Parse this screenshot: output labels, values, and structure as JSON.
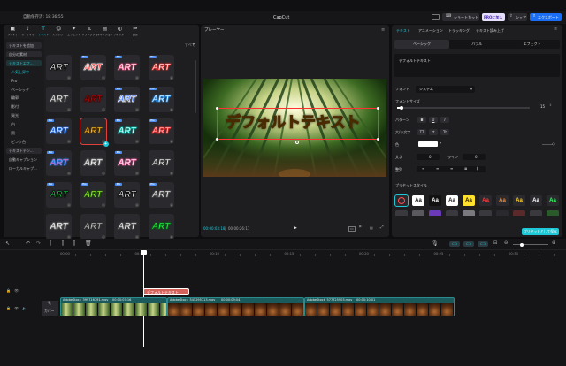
{
  "titlebar": {
    "autosave": "自動保存済: 18:36:55",
    "title": "CapCut",
    "shortcut": "ショートカット",
    "pro": "PROに加入",
    "share": "シェア",
    "export": "エクスポート"
  },
  "toolbar": {
    "tabs": [
      {
        "label": "メディア",
        "icon": "media-icon"
      },
      {
        "label": "オーディオ",
        "icon": "audio-icon"
      },
      {
        "label": "テキスト",
        "icon": "text-icon"
      },
      {
        "label": "ステッカー",
        "icon": "sticker-icon"
      },
      {
        "label": "エフェクト",
        "icon": "effect-icon"
      },
      {
        "label": "トランジション",
        "icon": "transition-icon"
      },
      {
        "label": "キャプション",
        "icon": "caption-icon"
      },
      {
        "label": "フィルター",
        "icon": "filter-icon"
      },
      {
        "label": "調整",
        "icon": "adjust-icon"
      }
    ]
  },
  "sidebar": {
    "items": [
      "テキストを追加",
      "自分の素材",
      "テキストエフ...",
      "人気上昇中",
      "Pro",
      "ベーシック",
      "輪郭",
      "影付",
      "発光",
      "白",
      "黒",
      "ピンク色",
      "テキストテン...",
      "自動キャプション",
      "ローカルキャプ..."
    ]
  },
  "filter_label": "すべて",
  "text_tiles": {
    "label": "ART",
    "styles": [
      {
        "color": "#ffffff",
        "stroke": "#000000",
        "pro": false,
        "bg": "#2a2a2e"
      },
      {
        "color": "#ff2a2a",
        "stroke": "#ffffff",
        "pro": true,
        "bg": "#2a2a2e"
      },
      {
        "color": "#ffffff",
        "stroke": "#ff5a8a",
        "pro": true,
        "bg": "#2a2a2e"
      },
      {
        "color": "#ffffff",
        "stroke": "#ff3030",
        "pro": true,
        "bg": "#2a2a2e"
      },
      {
        "color": "#ffffff",
        "stroke": "#555555",
        "pro": false,
        "bg": "#2a2a2e"
      },
      {
        "color": "#b01010",
        "stroke": "#400000",
        "pro": false,
        "bg": "#2a2a2e"
      },
      {
        "color": "#1e5cff",
        "stroke": "#ffffff",
        "pro": true,
        "bg": "#2a2a2e"
      },
      {
        "color": "#ffffff",
        "stroke": "#2a9bff",
        "pro": true,
        "bg": "#2a2a2e"
      },
      {
        "color": "#ffffff",
        "stroke": "#2d7bff",
        "pro": true,
        "bg": "#2a2a2e"
      },
      {
        "color": "#ffd22a",
        "stroke": "#5a3000",
        "pro": false,
        "bg": "#2a2a2e"
      },
      {
        "color": "#ffffff",
        "stroke": "#00d4c0",
        "pro": true,
        "bg": "#2a2a2e"
      },
      {
        "color": "#ffcccc",
        "stroke": "#ff2a2a",
        "pro": true,
        "bg": "#2a2a2e"
      },
      {
        "color": "#ff5aa0",
        "stroke": "#2a8cff",
        "pro": true,
        "bg": "#2a2a2e"
      },
      {
        "color": "#ffffff",
        "stroke": "#888888",
        "pro": false,
        "bg": "#2a2a2e"
      },
      {
        "color": "#ffffff",
        "stroke": "#ff66aa",
        "pro": true,
        "bg": "#2a2a2e"
      },
      {
        "color": "#ffffff",
        "stroke": "#444444",
        "pro": false,
        "bg": "#2a2a2e"
      },
      {
        "color": "#1ecf4a",
        "stroke": "#000000",
        "pro": true,
        "bg": "#2a2a2e"
      },
      {
        "color": "#b0ff3a",
        "stroke": "#1a5a00",
        "pro": true,
        "bg": "#2a2a2e"
      },
      {
        "color": "#ffffff",
        "stroke": "#000000",
        "pro": true,
        "bg": "#2a2a2e"
      },
      {
        "color": "#ffffff",
        "stroke": "#5a5a5a",
        "pro": true,
        "bg": "#2a2a2e"
      },
      {
        "color": "#ffffff",
        "stroke": "#888888",
        "pro": false,
        "bg": "#2a2a2e"
      },
      {
        "color": "#cccccc",
        "stroke": "#333333",
        "pro": false,
        "bg": "#2a2a2e"
      },
      {
        "color": "#ffffff",
        "stroke": "#666666",
        "pro": false,
        "bg": "#2a2a2e"
      },
      {
        "color": "#2aff4a",
        "stroke": "#006a10",
        "pro": false,
        "bg": "#2a2a2e"
      }
    ]
  },
  "player": {
    "title": "プレーヤー",
    "overlay_text": "デフォルトテキスト",
    "time_current": "00:00:03:18",
    "time_total": "00:00:26:11"
  },
  "inspector": {
    "tabs": [
      "テキスト",
      "アニメーション",
      "トラッキング",
      "テキスト読み上げ"
    ],
    "subtabs": [
      "ベーシック",
      "バブル",
      "エフェクト"
    ],
    "text_value": "デフォルトテキスト",
    "font_label": "フォント",
    "font_value": "システム",
    "size_label": "フォントサイズ",
    "size_value": "15",
    "pattern_label": "パターン",
    "pattern_buttons": [
      "B",
      "U",
      "I"
    ],
    "case_label": "大/小文字",
    "case_buttons": [
      "TT",
      "tt",
      "Tt"
    ],
    "color_label": "色",
    "spacing_label": "文字",
    "spacing_value": "0",
    "line_label": "ライン",
    "line_value": "0",
    "align_label": "整列",
    "preset_label": "プリセットスタイル",
    "save_preset": "プリセットとして保存",
    "preset_label_text": "Aa",
    "presets": [
      {
        "bg": "#2a2a2e",
        "color": "#ff5050",
        "stroke": "#ff5050",
        "type": "none"
      },
      {
        "bg": "#ffffff",
        "color": "#111111",
        "type": "aa"
      },
      {
        "bg": "#111111",
        "color": "#ffffff",
        "type": "aa"
      },
      {
        "bg": "#ffffff",
        "color": "#222222",
        "type": "aa"
      },
      {
        "bg": "#ffe02a",
        "color": "#111111",
        "type": "aa"
      },
      {
        "bg": "#2a2a2e",
        "color": "#ff3a3a",
        "type": "aa"
      },
      {
        "bg": "#2a2a2e",
        "color": "#ff8a2a",
        "type": "aa"
      },
      {
        "bg": "#2a2a2e",
        "color": "#ffd22a",
        "type": "aa"
      },
      {
        "bg": "#2a2a2e",
        "color": "#ffffff",
        "type": "aa"
      },
      {
        "bg": "#2a2a2e",
        "color": "#3aff6a",
        "type": "aa"
      }
    ]
  },
  "timeline": {
    "ruler": [
      "00:00",
      "00:05",
      "00:10",
      "00:15",
      "00:20",
      "00:25",
      "00:30"
    ],
    "text_clip": "デフォルトテキスト",
    "cover_label": "カバー",
    "clips": [
      {
        "name": "AdobeStock_399716791.mov",
        "duration": "00:00:07:16",
        "tone": "bamboo"
      },
      {
        "name": "AdobeStock_545295713.mov",
        "duration": "00:00:09:04",
        "tone": "coffee"
      },
      {
        "name": "AdobeStock_577725903.mov",
        "duration": "00:00:10:01",
        "tone": "coffee"
      }
    ]
  },
  "colors": {
    "accent": "#1ec8d6",
    "selection": "#e0403a",
    "export": "#1b6ef3"
  }
}
